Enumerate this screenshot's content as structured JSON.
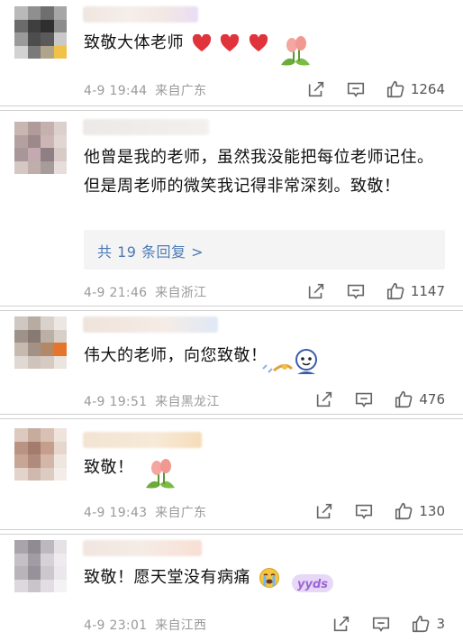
{
  "comments": [
    {
      "text": "致敬大体老师",
      "time": "4-9 19:44",
      "location": "来自广东",
      "likes": "1264",
      "emojis": [
        "red-heart",
        "red-heart",
        "red-heart",
        "tulip-sticker"
      ]
    },
    {
      "text": "他曾是我的老师，虽然我没能把每位老师记住。但是周老师的微笑我记得非常深刻。致敬！",
      "reply_link": "共 19 条回复 >",
      "time": "4-9 21:46",
      "location": "来自浙江",
      "likes": "1147"
    },
    {
      "text": "伟大的老师，向您致敬！",
      "time": "4-9 19:51",
      "location": "来自黑龙江",
      "likes": "476",
      "emojis": [
        "salute-sticker"
      ]
    },
    {
      "text": "致敬！",
      "time": "4-9 19:43",
      "location": "来自广东",
      "likes": "130",
      "emojis": [
        "tulip-sticker"
      ]
    },
    {
      "text": "致敬！愿天堂没有病痛",
      "time": "4-9 23:01",
      "location": "来自江西",
      "likes": "3",
      "emojis": [
        "crying-face",
        "yyds-sticker"
      ]
    }
  ],
  "icons": {
    "share": "share-icon",
    "comment": "comment-icon",
    "like": "thumbs-up-icon"
  },
  "colors": {
    "link": "#4a7ab5",
    "meta": "#9a9a9a",
    "heart": "#e0333b",
    "divider": "#cfcfcf"
  }
}
